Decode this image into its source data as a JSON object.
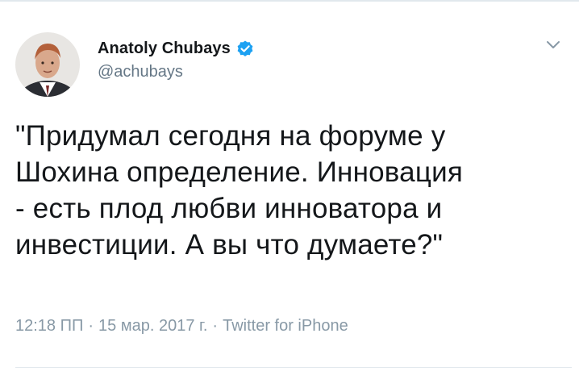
{
  "tweet": {
    "author": {
      "display_name": "Anatoly Chubays",
      "handle": "@achubays",
      "verified": true,
      "avatar_icon": "profile-photo"
    },
    "menu_icon": "chevron-down-icon",
    "text_lines": [
      "\"Придумал сегодня на форуме у",
      "Шохина определение. Инновация",
      "- есть плод любви инноватора и",
      "инвестиции. А вы что думаете?\""
    ],
    "meta": {
      "time": "12:18 ПП",
      "separator": "·",
      "date": "15 мар. 2017 г.",
      "source": "Twitter for iPhone"
    }
  },
  "colors": {
    "text": "#14171a",
    "secondary": "#657786",
    "meta": "#8899a6",
    "verified_badge": "#1da1f2",
    "divider": "#e1e8ed"
  }
}
